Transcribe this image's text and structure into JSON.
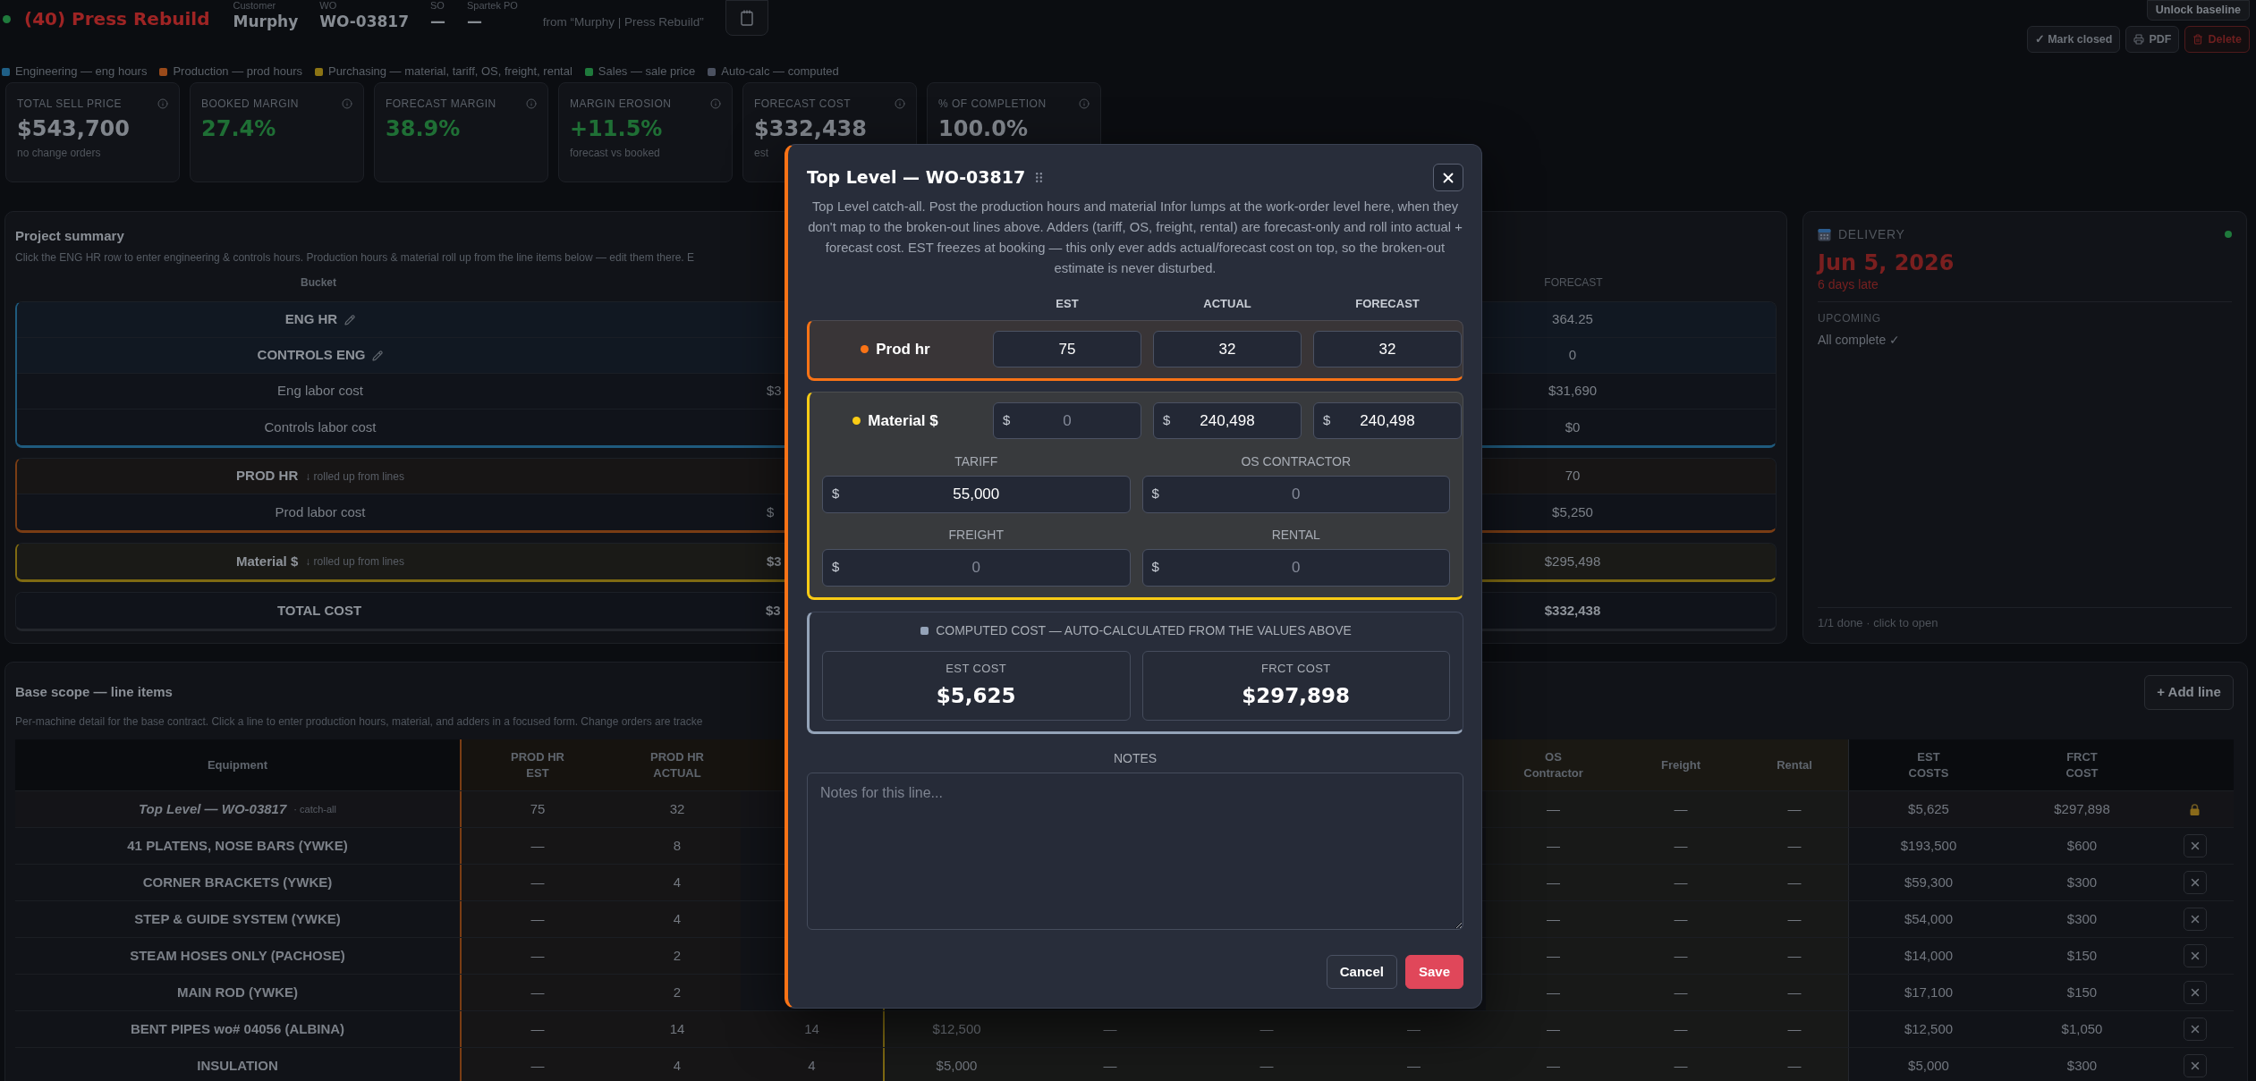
{
  "header": {
    "title": "(40) Press Rebuild",
    "fields": [
      {
        "label": "Customer",
        "value": "Murphy"
      },
      {
        "label": "WO",
        "value": "WO-03817"
      },
      {
        "label": "SO",
        "value": "—"
      },
      {
        "label": "Spartek PO",
        "value": "—"
      }
    ],
    "source": "from “Murphy | Press Rebuild”",
    "unlock_button": "Unlock baseline",
    "actions": [
      {
        "label": "✓ Mark closed",
        "kind": "plain"
      },
      {
        "label": "PDF",
        "kind": "print"
      },
      {
        "label": "Delete",
        "kind": "delete"
      }
    ]
  },
  "legend": [
    {
      "label": "Engineering — eng hours",
      "color": "#1f5f86"
    },
    {
      "label": "Production — prod hours",
      "color": "#9a4a1a"
    },
    {
      "label": "Purchasing — material, tariff, OS, freight, rental",
      "color": "#8c7414"
    },
    {
      "label": "Sales — sale price",
      "color": "#1f7a3c"
    },
    {
      "label": "Auto-calc — computed",
      "color": "#4b5160"
    }
  ],
  "kpis": [
    {
      "label": "TOTAL SELL PRICE",
      "value": "$543,700",
      "note": "no change orders",
      "color": "#80858c"
    },
    {
      "label": "BOOKED MARGIN",
      "value": "27.4%",
      "color": "#1f6f35"
    },
    {
      "label": "FORECAST MARGIN",
      "value": "38.9%",
      "color": "#1f6f35"
    },
    {
      "label": "MARGIN EROSION",
      "value": "+11.5%",
      "note": "forecast vs booked",
      "color": "#1f6f35"
    },
    {
      "label": "FORECAST COST",
      "value": "$332,438",
      "note": "est",
      "color": "#80858c"
    },
    {
      "label": "% OF COMPLETION",
      "value": "100.0%",
      "color": "#80858c"
    }
  ],
  "project_summary": {
    "title": "Project summary",
    "description": "Click the ENG HR row to enter engineering & controls hours. Production hours & material roll up from the line items below — edit them there. E",
    "columns": {
      "bucket": "Bucket",
      "forecast": "FORECAST"
    },
    "groups": [
      {
        "kind": "engineering",
        "rows": [
          {
            "kind": "input",
            "bucket": "ENG HR",
            "editable": true,
            "forecast": "364.25"
          },
          {
            "kind": "input",
            "bucket": "CONTROLS ENG",
            "editable": true,
            "forecast": "0"
          },
          {
            "kind": "cost",
            "bucket": "Eng labor cost",
            "column_2": "$3",
            "forecast": "$31,690"
          },
          {
            "kind": "cost",
            "bucket": "Controls labor cost",
            "forecast": "$0"
          }
        ]
      },
      {
        "kind": "production",
        "rows": [
          {
            "kind": "input",
            "bucket": "PROD HR",
            "note": "↓ rolled up from lines",
            "forecast": "70"
          },
          {
            "kind": "cost",
            "bucket": "Prod labor cost",
            "column_2": "$",
            "forecast": "$5,250"
          }
        ]
      },
      {
        "kind": "material",
        "rows": [
          {
            "kind": "input",
            "bucket": "Material $",
            "note": "↓ rolled up from lines",
            "column_2": "$3",
            "forecast": "$295,498"
          }
        ]
      },
      {
        "kind": "total",
        "rows": [
          {
            "kind": "total",
            "bucket": "TOTAL COST",
            "column_2": "$3",
            "forecast": "$332,438"
          }
        ]
      }
    ]
  },
  "delivery": {
    "title": "DELIVERY",
    "date": "Jun 5, 2026",
    "status": "6 days late",
    "upcoming_label": "UPCOMING",
    "upcoming": "All complete ✓",
    "footer": "1/1 done · click to open"
  },
  "base_scope": {
    "title": "Base scope — line items",
    "description": "Per-machine detail for the base contract. Click a line to enter production hours, material, and adders in a focused form. Change orders are tracke",
    "add_button": "+ Add line",
    "table": {
      "header": {
        "equipment": "Equipment",
        "prod_hr_est": "PROD HR\nEST",
        "prod_hr_actual": "PROD HR\nACTUAL",
        "os_contractor": "OS\nContractor",
        "freight": "Freight",
        "rental": "Rental",
        "est_costs": "EST\nCOSTS",
        "frct_cost": "FRCT\nCOST"
      },
      "rows": [
        {
          "kind": "catch_all",
          "equipment": "Top Level — WO-03817",
          "note": "· catch-all",
          "prod_hr_est": "75",
          "prod_hr_actual": "32",
          "os_contractor": "—",
          "freight": "—",
          "rental": "—",
          "est_costs": "$5,625",
          "frct_cost": "$297,898"
        },
        {
          "kind": "line",
          "equipment": "41 PLATENS, NOSE BARS (YWKE)",
          "prod_hr_est": "—",
          "prod_hr_actual": "8",
          "os_contractor": "—",
          "freight": "—",
          "rental": "—",
          "est_costs": "$193,500",
          "frct_cost": "$600"
        },
        {
          "kind": "line",
          "equipment": "CORNER BRACKETS (YWKE)",
          "prod_hr_est": "—",
          "prod_hr_actual": "4",
          "os_contractor": "—",
          "freight": "—",
          "rental": "—",
          "est_costs": "$59,300",
          "frct_cost": "$300"
        },
        {
          "kind": "line",
          "equipment": "STEP & GUIDE SYSTEM (YWKE)",
          "prod_hr_est": "—",
          "prod_hr_actual": "4",
          "os_contractor": "—",
          "freight": "—",
          "rental": "—",
          "est_costs": "$54,000",
          "frct_cost": "$300"
        },
        {
          "kind": "line",
          "equipment": "STEAM HOSES ONLY (PACHOSE)",
          "prod_hr_est": "—",
          "prod_hr_actual": "2",
          "os_contractor": "—",
          "freight": "—",
          "rental": "—",
          "est_costs": "$14,000",
          "frct_cost": "$150"
        },
        {
          "kind": "line",
          "equipment": "MAIN ROD (YWKE)",
          "prod_hr_est": "—",
          "prod_hr_actual": "2",
          "os_contractor": "—",
          "freight": "—",
          "rental": "—",
          "est_costs": "$17,100",
          "frct_cost": "$150"
        },
        {
          "kind": "line",
          "equipment": "BENT PIPES wo# 04056 (ALBINA)",
          "prod_hr_est": "—",
          "prod_hr_actual": "14",
          "column_4": "14",
          "column_5": "$12,500",
          "column_6": "—",
          "column_7": "—",
          "column_8": "—",
          "os_contractor": "—",
          "freight": "—",
          "rental": "—",
          "est_costs": "$12,500",
          "frct_cost": "$1,050"
        },
        {
          "kind": "line",
          "equipment": "INSULATION",
          "prod_hr_est": "—",
          "prod_hr_actual": "4",
          "column_4": "4",
          "column_5": "$5,000",
          "column_6": "—",
          "column_7": "—",
          "column_8": "—",
          "os_contractor": "—",
          "freight": "—",
          "rental": "—",
          "est_costs": "$5,000",
          "frct_cost": "$300"
        }
      ]
    }
  },
  "modal": {
    "title": "Top Level — WO-03817",
    "description": "Top Level catch-all. Post the production hours and material Infor lumps at the work-order level here, when they don't map to the broken-out lines above. Adders (tariff, OS, freight, rental) are forecast-only and roll into actual + forecast cost. EST freezes at booking — this only ever adds actual/forecast cost on top, so the broken-out estimate is never disturbed.",
    "columns": [
      "EST",
      "ACTUAL",
      "FORECAST"
    ],
    "sections": [
      {
        "kind": "hours",
        "label": "Prod hr",
        "color": "#f97316",
        "fields": [
          {
            "value": "75"
          },
          {
            "value": "32"
          },
          {
            "value": "32"
          }
        ]
      },
      {
        "kind": "money",
        "label": "Material $",
        "color": "#facc15",
        "fields": [
          {
            "prefix": "$",
            "placeholder": "0"
          },
          {
            "prefix": "$",
            "value": "240,498"
          },
          {
            "prefix": "$",
            "value": "240,498"
          }
        ],
        "adders": [
          {
            "label": "TARIFF",
            "prefix": "$",
            "value": "55,000"
          },
          {
            "label": "OS CONTRACTOR",
            "prefix": "$",
            "placeholder": "0"
          },
          {
            "label": "FREIGHT",
            "prefix": "$",
            "placeholder": "0"
          },
          {
            "label": "RENTAL",
            "prefix": "$",
            "placeholder": "0"
          }
        ]
      }
    ],
    "computed": {
      "title": "COMPUTED COST — AUTO-CALCULATED FROM THE VALUES ABOVE",
      "items": [
        {
          "label": "EST COST",
          "value": "$5,625"
        },
        {
          "label": "FRCT COST",
          "value": "$297,898"
        }
      ]
    },
    "notes": {
      "label": "NOTES",
      "placeholder": "Notes for this line..."
    },
    "buttons": [
      {
        "label": "Cancel",
        "kind": "secondary"
      },
      {
        "label": "Save",
        "kind": "primary"
      }
    ]
  }
}
